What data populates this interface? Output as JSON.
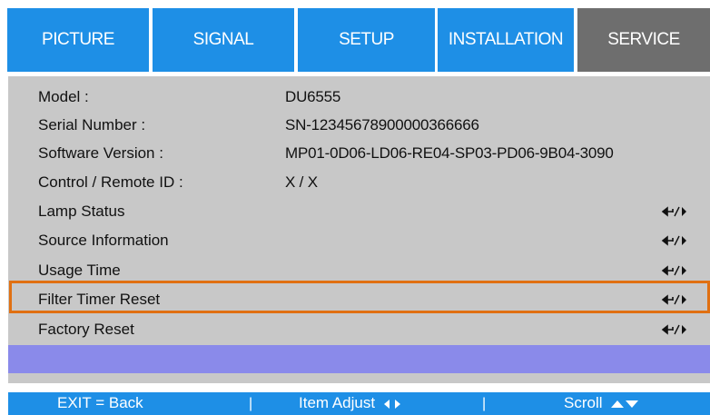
{
  "tabs": [
    {
      "label": "PICTURE"
    },
    {
      "label": "SIGNAL"
    },
    {
      "label": "SETUP"
    },
    {
      "label": "INSTALLATION"
    },
    {
      "label": "SERVICE"
    }
  ],
  "active_tab": "SERVICE",
  "info": {
    "model": {
      "label": "Model :",
      "value": "DU6555"
    },
    "serial": {
      "label": "Serial Number :",
      "value": "SN-12345678900000366666"
    },
    "software": {
      "label": "Software Version :",
      "value": "MP01-0D06-LD06-RE04-SP03-PD06-9B04-3090"
    },
    "control": {
      "label": "Control / Remote ID :",
      "value": "X / X"
    }
  },
  "menu_items": [
    {
      "label": "Lamp Status",
      "action_icon": "enter-right-icon"
    },
    {
      "label": "Source Information",
      "action_icon": "enter-right-icon"
    },
    {
      "label": "Usage Time",
      "action_icon": "enter-right-icon"
    },
    {
      "label": "Filter Timer Reset",
      "action_icon": "enter-right-icon"
    },
    {
      "label": "Factory Reset",
      "action_icon": "enter-right-icon"
    }
  ],
  "highlighted_item": "Filter Timer Reset",
  "footer": {
    "exit": "EXIT = Back",
    "sep": "|",
    "adjust": "Item Adjust",
    "scroll": "Scroll"
  },
  "colors": {
    "tab_blue": "#1e8fe6",
    "tab_active": "#6e6e6e",
    "panel": "#c8c8c8",
    "selection_bar": "#8a8aea",
    "highlight_outline": "#e07012"
  }
}
